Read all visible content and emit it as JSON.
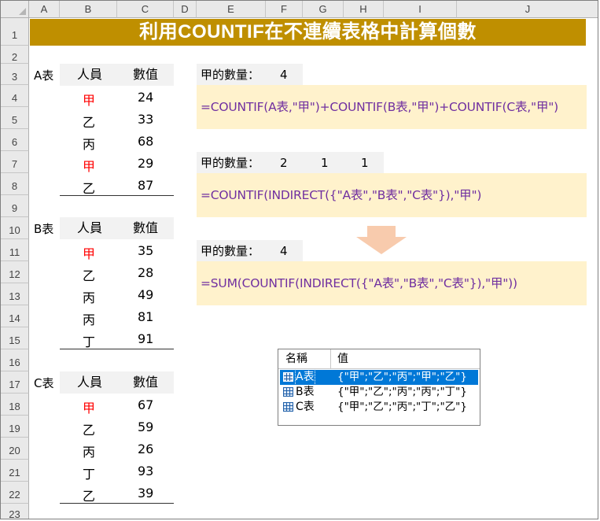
{
  "columns": [
    "A",
    "B",
    "C",
    "D",
    "E",
    "F",
    "G",
    "H",
    "I",
    "J"
  ],
  "rows": [
    "1",
    "2",
    "3",
    "4",
    "5",
    "6",
    "7",
    "8",
    "9",
    "10",
    "11",
    "12",
    "13",
    "14",
    "15",
    "16",
    "17",
    "18",
    "19",
    "20",
    "21",
    "22",
    "23"
  ],
  "title": "利用COUNTIF在不連續表格中計算個數",
  "tables": [
    {
      "label": "A表",
      "col1": "人員",
      "col2": "數值",
      "data": [
        [
          "甲",
          "24"
        ],
        [
          "乙",
          "33"
        ],
        [
          "丙",
          "68"
        ],
        [
          "甲",
          "29"
        ],
        [
          "乙",
          "87"
        ]
      ]
    },
    {
      "label": "B表",
      "col1": "人員",
      "col2": "數值",
      "data": [
        [
          "甲",
          "35"
        ],
        [
          "乙",
          "28"
        ],
        [
          "丙",
          "49"
        ],
        [
          "丙",
          "81"
        ],
        [
          "丁",
          "91"
        ]
      ]
    },
    {
      "label": "C表",
      "col1": "人員",
      "col2": "數值",
      "data": [
        [
          "甲",
          "67"
        ],
        [
          "乙",
          "59"
        ],
        [
          "丙",
          "26"
        ],
        [
          "丁",
          "93"
        ],
        [
          "乙",
          "39"
        ]
      ]
    }
  ],
  "highlight_color": "#ff0000",
  "title_color": "#bf8f00",
  "formula_color": "#7030a0",
  "formula_bg": "#fff2cc",
  "result1": {
    "label": "甲的數量：",
    "values": [
      "4"
    ]
  },
  "formula1": "=COUNTIF(A表,\"甲\")+COUNTIF(B表,\"甲\")+COUNTIF(C表,\"甲\")",
  "result2": {
    "label": "甲的數量：",
    "values": [
      "2",
      "1",
      "1"
    ]
  },
  "formula2": "=COUNTIF(INDIRECT({\"A表\",\"B表\",\"C表\"}),\"甲\")",
  "result3": {
    "label": "甲的數量：",
    "values": [
      "4"
    ]
  },
  "formula3": "=SUM(COUNTIF(INDIRECT({\"A表\",\"B表\",\"C表\"}),\"甲\"))",
  "arrow_icon": "down-arrow-icon",
  "name_manager": {
    "col_name": "名稱",
    "col_value": "值",
    "items": [
      {
        "name": "A表",
        "value": "{\"甲\";\"乙\";\"丙\";\"甲\";\"乙\"}",
        "selected": true
      },
      {
        "name": "B表",
        "value": "{\"甲\";\"乙\";\"丙\";\"丙\";\"丁\"}",
        "selected": false
      },
      {
        "name": "C表",
        "value": "{\"甲\";\"乙\";\"丙\";\"丁\";\"乙\"}",
        "selected": false
      }
    ]
  }
}
